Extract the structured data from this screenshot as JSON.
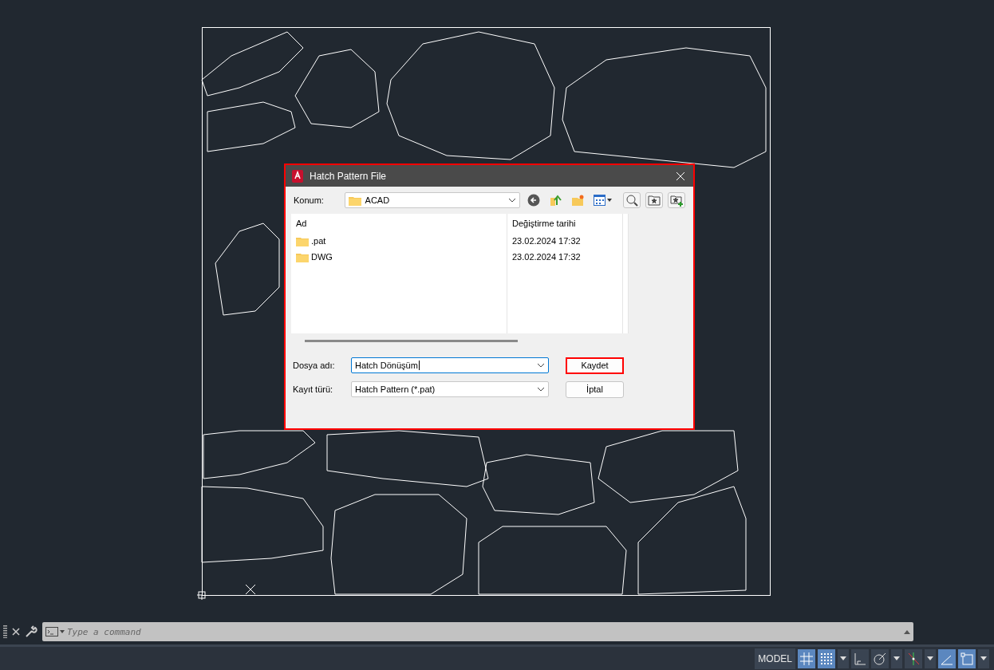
{
  "dialog": {
    "title": "Hatch Pattern File",
    "location_label": "Konum:",
    "location_value": "ACAD",
    "columns": [
      {
        "label": "Ad"
      },
      {
        "label": "Değiştirme tarihi"
      }
    ],
    "rows": [
      {
        "name": ".pat",
        "modified": "23.02.2024 17:32"
      },
      {
        "name": "DWG",
        "modified": "23.02.2024 17:32"
      }
    ],
    "filename_label": "Dosya adı:",
    "filename_value": "Hatch Dönüşüm",
    "filetype_label": "Kayıt türü:",
    "filetype_value": "Hatch Pattern (*.pat)",
    "buttons": [
      {
        "label": "Kaydet",
        "focused": true
      },
      {
        "label": "İptal",
        "focused": false
      }
    ]
  },
  "command_line": {
    "placeholder": "Type a command"
  },
  "status_bar": {
    "model_label": "MODEL",
    "toggles": [
      {
        "kind": "grid",
        "on": true
      },
      {
        "kind": "snap",
        "on": true
      },
      {
        "kind": "menu",
        "on": false
      },
      {
        "kind": "ortho",
        "on": false
      },
      {
        "kind": "polar",
        "on": false
      },
      {
        "kind": "menu",
        "on": false
      },
      {
        "kind": "track",
        "on": false
      },
      {
        "kind": "menu",
        "on": false
      },
      {
        "kind": "dyn",
        "on": true
      },
      {
        "kind": "select",
        "on": true
      },
      {
        "kind": "menu",
        "on": false
      }
    ]
  }
}
